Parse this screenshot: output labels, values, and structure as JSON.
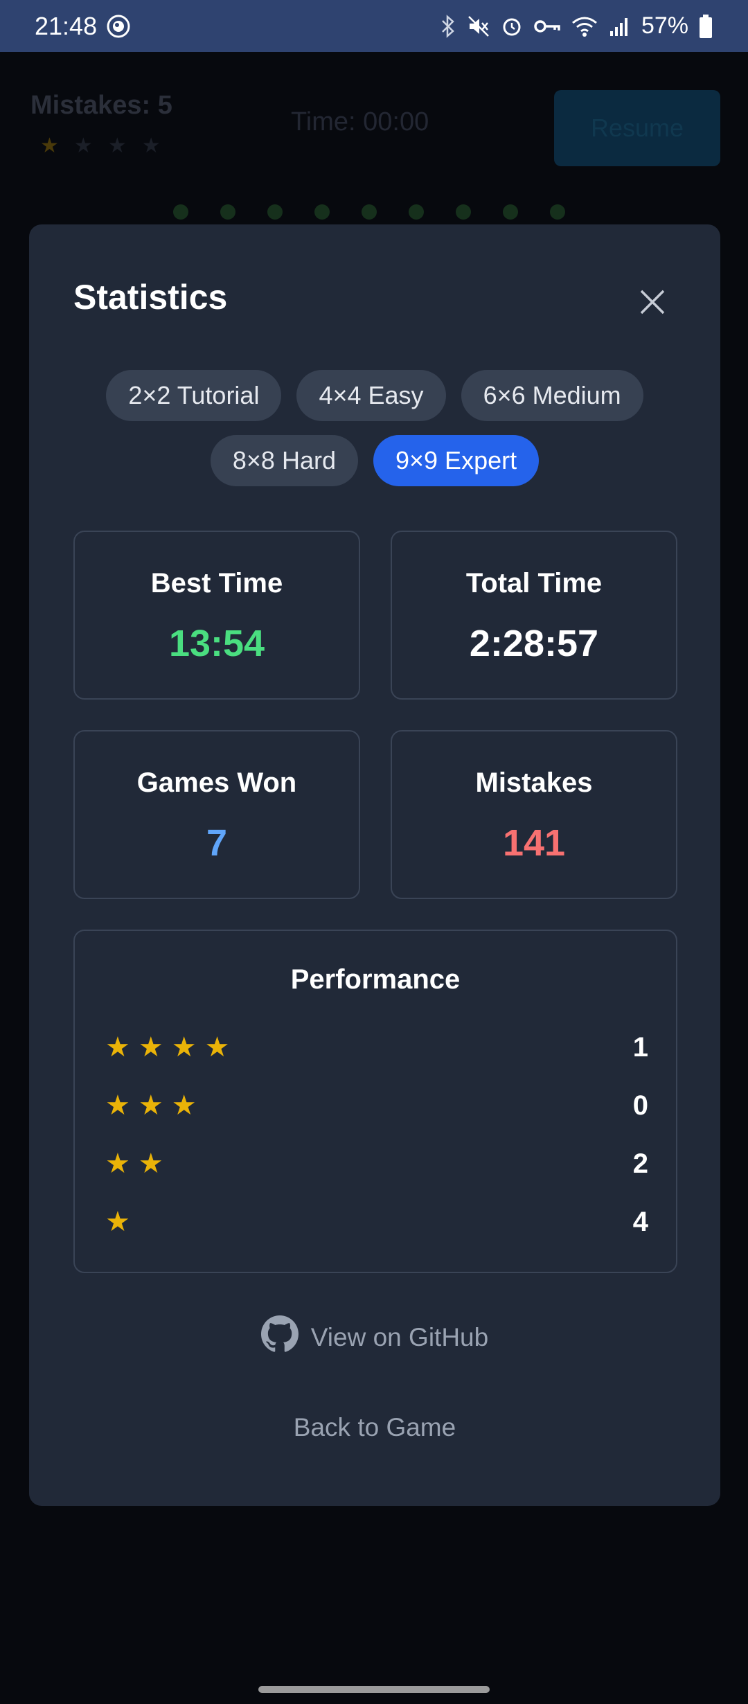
{
  "status_bar": {
    "time": "21:48",
    "battery": "57%",
    "icons": [
      "bluetooth-icon",
      "mute-icon",
      "alarm-icon",
      "vpn-key-icon",
      "wifi-icon",
      "signal-icon",
      "battery-icon"
    ]
  },
  "background": {
    "title": "Mistakes: 5",
    "timer": "Time: 00:00",
    "resume_label": "Resume"
  },
  "modal": {
    "title": "Statistics",
    "tabs": [
      {
        "label": "2×2 Tutorial",
        "active": false
      },
      {
        "label": "4×4 Easy",
        "active": false
      },
      {
        "label": "6×6 Medium",
        "active": false
      },
      {
        "label": "8×8 Hard",
        "active": false
      },
      {
        "label": "9×9 Expert",
        "active": true
      }
    ],
    "stats": {
      "best_time": {
        "label": "Best Time",
        "value": "13:54",
        "color": "#4ade80"
      },
      "total_time": {
        "label": "Total Time",
        "value": "2:28:57",
        "color": "#ffffff"
      },
      "games_won": {
        "label": "Games Won",
        "value": "7",
        "color": "#60a5fa"
      },
      "mistakes": {
        "label": "Mistakes",
        "value": "141",
        "color": "#f87171"
      }
    },
    "performance": {
      "title": "Performance",
      "rows": [
        {
          "stars": 4,
          "count": "1"
        },
        {
          "stars": 3,
          "count": "0"
        },
        {
          "stars": 2,
          "count": "2"
        },
        {
          "stars": 1,
          "count": "4"
        }
      ]
    },
    "github_label": "View on GitHub",
    "back_label": "Back to Game"
  },
  "colors": {
    "accent": "#2563eb",
    "star": "#eab308",
    "modal_bg": "#212938"
  }
}
